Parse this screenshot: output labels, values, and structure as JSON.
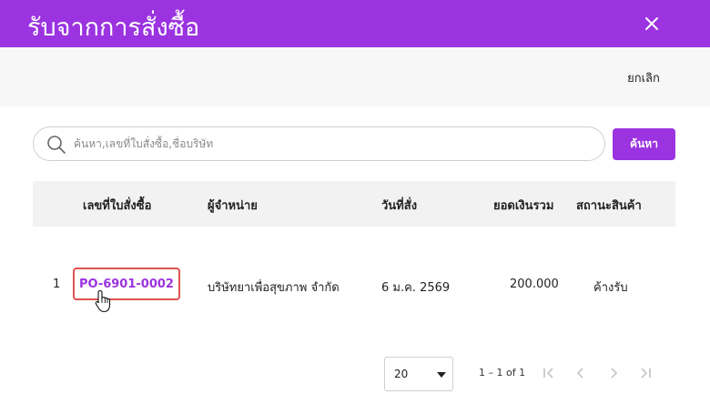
{
  "dialog": {
    "title": "รับจากการสั่งซื้อ",
    "close_icon": "close-icon"
  },
  "actions": {
    "cancel_label": "ยกเลิก"
  },
  "search": {
    "placeholder": "ค้นหา,เลขที่ใบสั่งซื้อ,ชื่อบริษัท",
    "value": "",
    "button_label": "ค้นหา",
    "icon": "search-icon"
  },
  "table": {
    "columns": {
      "po_number": "เลขที่ใบสั่งซื้อ",
      "supplier": "ผู้จำหน่าย",
      "order_date": "วันที่สั่ง",
      "total": "ยอดเงินรวม",
      "status": "สถานะสินค้า"
    },
    "rows": [
      {
        "index": "1",
        "po_number": "PO-6901-0002",
        "supplier": "บริษัทยาเพื่อสุขภาพ จำกัด",
        "order_date": "6 ม.ค. 2569",
        "total": "200.000",
        "status": "ค้างรับ"
      }
    ]
  },
  "pagination": {
    "page_size": "20",
    "range_text": "1 – 1 of 1",
    "icons": [
      "first-page-icon",
      "previous-page-icon",
      "next-page-icon",
      "last-page-icon"
    ]
  },
  "colors": {
    "accent": "#9b34e0",
    "highlight_border": "#e05252"
  }
}
